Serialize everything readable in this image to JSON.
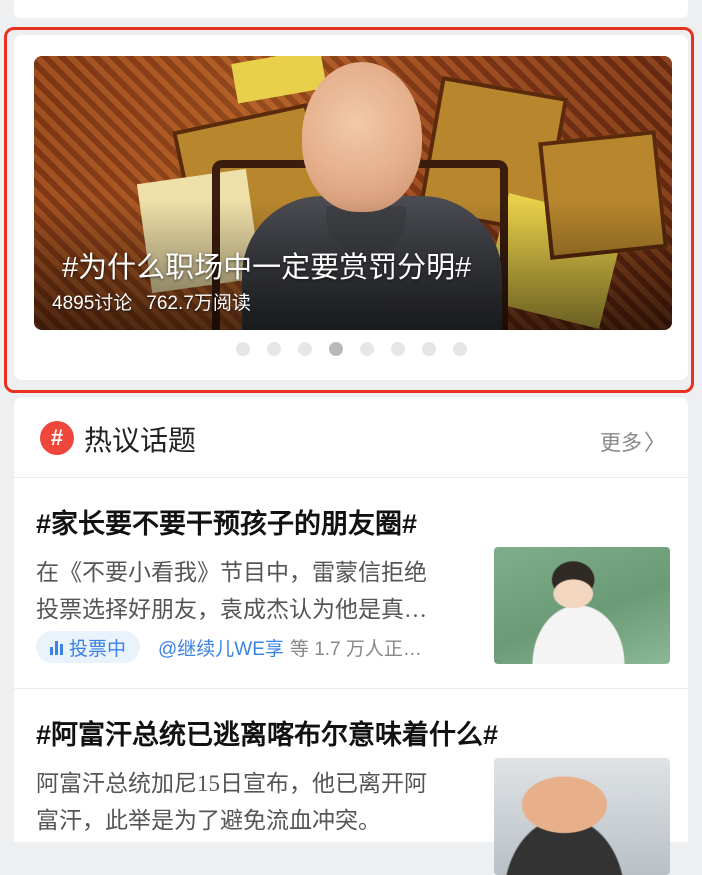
{
  "banner": {
    "title": "#为什么职场中一定要赏罚分明#",
    "discussions": "4895讨论",
    "reads": "762.7万阅读",
    "slide_count": 8,
    "active_slide": 4
  },
  "hot_topics": {
    "icon": "hash-icon",
    "icon_glyph": "#",
    "title": "热议话题",
    "more_label": "更多",
    "more_chevron": "〉",
    "items": [
      {
        "title": "#家长要不要干预孩子的朋友圈#",
        "desc_line1": "在《不要小看我》节目中，雷蒙信拒绝",
        "desc_line2": "投票选择好朋友，袁成杰认为他是真…",
        "badge_label": "投票中",
        "user": "@继续儿WE享",
        "rest": "等 1.7 万人正…"
      },
      {
        "title": "#阿富汗总统已逃离喀布尔意味着什么#",
        "desc_line1": "阿富汗总统加尼15日宣布，他已离开阿",
        "desc_line2": "富汗，此举是为了避免流血冲突。"
      }
    ]
  },
  "colors": {
    "highlight_border": "#e8321f",
    "hash_icon_bg": "#f0473c",
    "accent_blue": "#3a83e4"
  }
}
